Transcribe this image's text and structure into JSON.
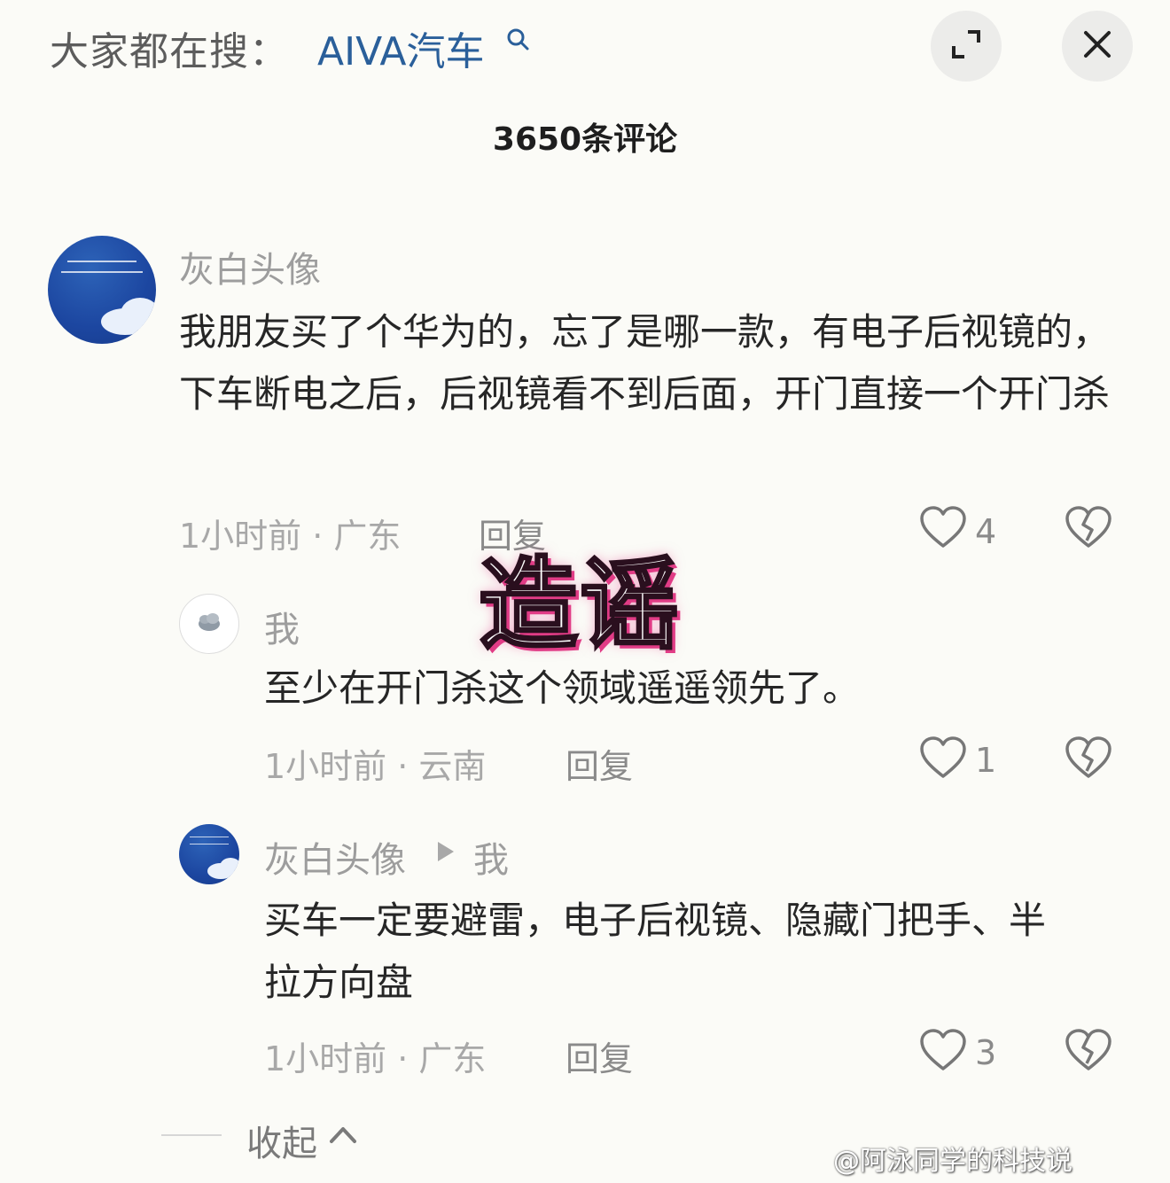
{
  "header": {
    "search_prefix": "大家都在搜：",
    "search_term": "AIVA汽车",
    "comment_count_title": "3650条评论"
  },
  "comments": [
    {
      "username": "灰白头像",
      "text": "我朋友买了个华为的，忘了是哪一款，有电子后视镜的，下车断电之后，后视镜看不到后面，开门直接一个开门杀",
      "meta": "1小时前 · 广东",
      "reply_label": "回复",
      "like_count": "4"
    }
  ],
  "replies": [
    {
      "username": "我",
      "text": "至少在开门杀这个领域遥遥领先了。",
      "meta": "1小时前 · 云南",
      "reply_label": "回复",
      "like_count": "1"
    },
    {
      "username": "灰白头像",
      "reply_to": "我",
      "text": "买车一定要避雷，电子后视镜、隐藏门把手、半拉方向盘",
      "meta": "1小时前 · 广东",
      "reply_label": "回复",
      "like_count": "3"
    }
  ],
  "overlay_stamp": "造谣",
  "footer": {
    "collapse_label": "收起"
  },
  "watermark": "@阿泳同学的科技说",
  "icons": {
    "search": "search-icon",
    "expand": "expand-icon",
    "close": "close-icon",
    "like": "heart-icon",
    "dislike": "broken-heart-icon",
    "collapse": "chevron-up-icon",
    "reply_arrow": "play-triangle-icon"
  },
  "colors": {
    "background": "#fbfbf7",
    "search_term": "#2a5f9a",
    "stamp_shadow": "#e13c86"
  }
}
